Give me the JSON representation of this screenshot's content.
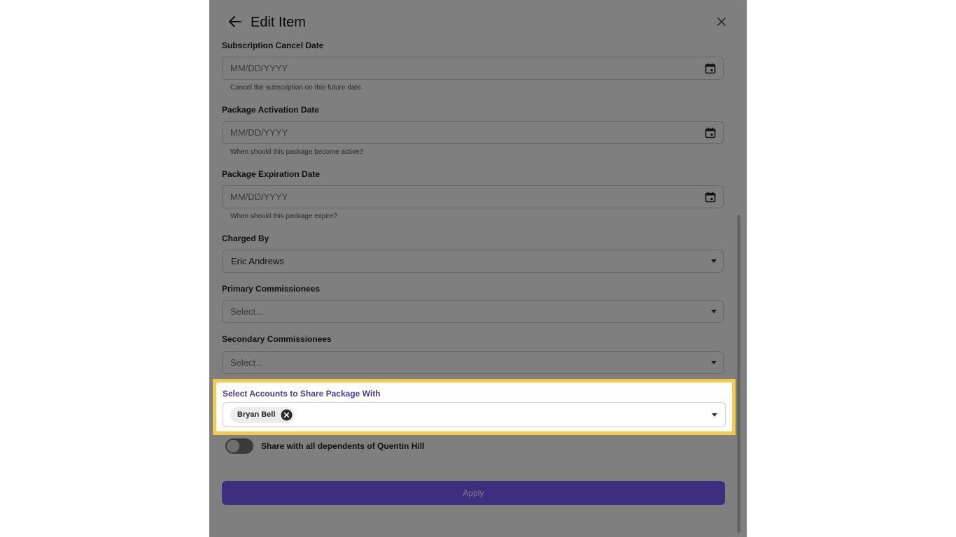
{
  "modal": {
    "title": "Edit Item",
    "fields": {
      "cancel_date": {
        "label": "Subscription Cancel Date",
        "placeholder": "MM/DD/YYYY",
        "helper": "Cancel the subscription on this future date."
      },
      "activation_date": {
        "label": "Package Activation Date",
        "placeholder": "MM/DD/YYYY",
        "helper": "When should this package become active?"
      },
      "expiration_date": {
        "label": "Package Expiration Date",
        "placeholder": "MM/DD/YYYY",
        "helper": "When should this package expire?"
      },
      "charged_by": {
        "label": "Charged By",
        "value": "Eric Andrews"
      },
      "primary_commissionees": {
        "label": "Primary Commissionees",
        "placeholder": "Select..."
      },
      "secondary_commissionees": {
        "label": "Secondary Commissionees",
        "placeholder": "Select..."
      },
      "share_accounts": {
        "label": "Select Accounts to Share Package With",
        "chips": [
          "Bryan Bell"
        ]
      }
    },
    "toggle": {
      "label": "Share with all dependents of Quentin Hill",
      "checked": false
    },
    "apply_label": "Apply"
  },
  "colors": {
    "accent": "#7b5cff",
    "highlight": "#f7c948",
    "share_label": "#4a3a9e"
  }
}
